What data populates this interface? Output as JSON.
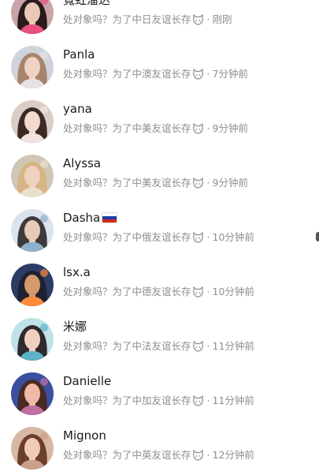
{
  "chats": [
    {
      "name": "寬虹溜达",
      "preview": "处对象吗？为了中日友谊长存",
      "time": "刚刚",
      "avatar": {
        "bg": "#c9a5a8",
        "skin": "#ecc6b6",
        "hair": "#2a1b1c",
        "accent": "#e8507e"
      }
    },
    {
      "name": "Panla",
      "preview": "处对象吗？为了中澳友谊长存",
      "time": "7分钟前",
      "avatar": {
        "bg": "#cfd3dc",
        "skin": "#f0d2c4",
        "hair": "#a7846a",
        "accent": "#e7e2e6"
      }
    },
    {
      "name": "yana",
      "preview": "处对象吗？为了中美友谊长存",
      "time": "9分钟前",
      "avatar": {
        "bg": "#d9cdc6",
        "skin": "#f3d9cf",
        "hair": "#3b2a24",
        "accent": "#f1e3de"
      }
    },
    {
      "name": "Alyssa",
      "preview": "处对象吗？为了中美友谊长存",
      "time": "9分钟前",
      "avatar": {
        "bg": "#cfc6b5",
        "skin": "#f1d2c1",
        "hair": "#d6b483",
        "accent": "#e9dfcf"
      }
    },
    {
      "name": "Dasha",
      "preview": "处对象吗？为了中俄友谊长存",
      "time": "10分钟前",
      "avatar": {
        "bg": "#dbe4ec",
        "skin": "#e7cbb6",
        "hair": "#3c3a3c",
        "accent": "#8fb0cc"
      },
      "flag": "russia-flag"
    },
    {
      "name": "lsx.a",
      "preview": "处对象吗？为了中德友谊长存",
      "time": "10分钟前",
      "avatar": {
        "bg": "#2c3c66",
        "skin": "#d49a6a",
        "hair": "#1e2230",
        "accent": "#ff8a3a"
      }
    },
    {
      "name": "米娜",
      "preview": "处对象吗？为了中法友谊长存",
      "time": "11分钟前",
      "avatar": {
        "bg": "#bfe1e8",
        "skin": "#f2d0c1",
        "hair": "#2e2a2e",
        "accent": "#5bb3c4"
      }
    },
    {
      "name": "Danielle",
      "preview": "处对象吗？为了中加友谊长存",
      "time": "11分钟前",
      "avatar": {
        "bg": "#3a4fa0",
        "skin": "#efb9a6",
        "hair": "#4a2a22",
        "accent": "#c06fa0"
      }
    },
    {
      "name": "Mignon",
      "preview": "处对象吗？为了中英友谊长存",
      "time": "12分钟前",
      "avatar": {
        "bg": "#d6b8a4",
        "skin": "#f0cbb6",
        "hair": "#6b3f2c",
        "accent": "#caa08a"
      }
    }
  ],
  "icons": {
    "status": "cat-face-icon",
    "separator": "·"
  },
  "colors": {
    "name": "#1a1a1a",
    "preview": "#8e8e93"
  }
}
